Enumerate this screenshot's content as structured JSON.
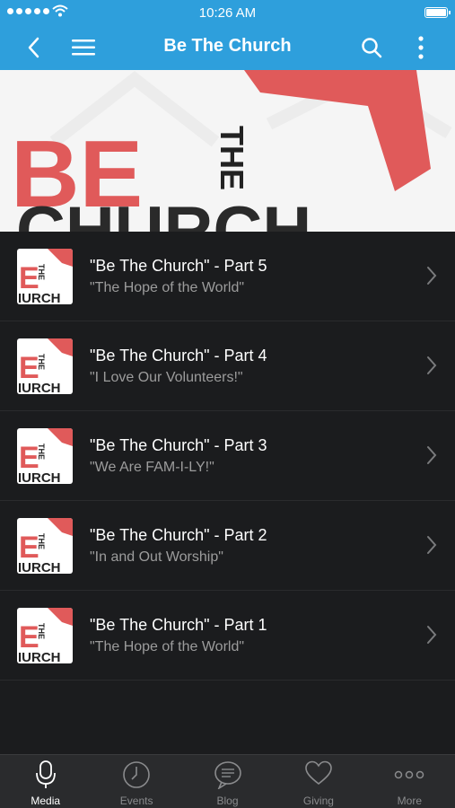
{
  "status_bar": {
    "time": "10:26 AM"
  },
  "nav": {
    "title": "Be The Church",
    "back_icon": "chevron-left-icon",
    "menu_icon": "hamburger-menu-icon",
    "search_icon": "search-icon",
    "more_icon": "vertical-ellipsis-icon"
  },
  "hero": {
    "big_text": "BE",
    "side_text": "THE",
    "bottom_text": "CHURCH",
    "accent_color": "#e05a5a"
  },
  "thumb": {
    "big_letter": "E",
    "side_text": "THE",
    "bottom_text": "IURCH"
  },
  "items": [
    {
      "title": "\"Be The Church\" - Part 5",
      "subtitle": "\"The Hope of the World\""
    },
    {
      "title": "\"Be The Church\" - Part 4",
      "subtitle": "\"I Love Our Volunteers!\""
    },
    {
      "title": "\"Be The Church\" - Part 3",
      "subtitle": "\"We Are FAM-I-LY!\""
    },
    {
      "title": "\"Be The Church\" - Part 2",
      "subtitle": "\"In and Out Worship\""
    },
    {
      "title": "\"Be The Church\" - Part 1",
      "subtitle": "\"The Hope of the World\""
    }
  ],
  "tabs": [
    {
      "label": "Media",
      "icon": "microphone-icon",
      "active": true
    },
    {
      "label": "Events",
      "icon": "clock-icon",
      "active": false
    },
    {
      "label": "Blog",
      "icon": "chat-bubble-icon",
      "active": false
    },
    {
      "label": "Giving",
      "icon": "heart-icon",
      "active": false
    },
    {
      "label": "More",
      "icon": "more-dots-icon",
      "active": false
    }
  ],
  "colors": {
    "brand_blue": "#2e9fdc",
    "accent_red": "#e05a5a",
    "background": "#1b1c1e"
  }
}
